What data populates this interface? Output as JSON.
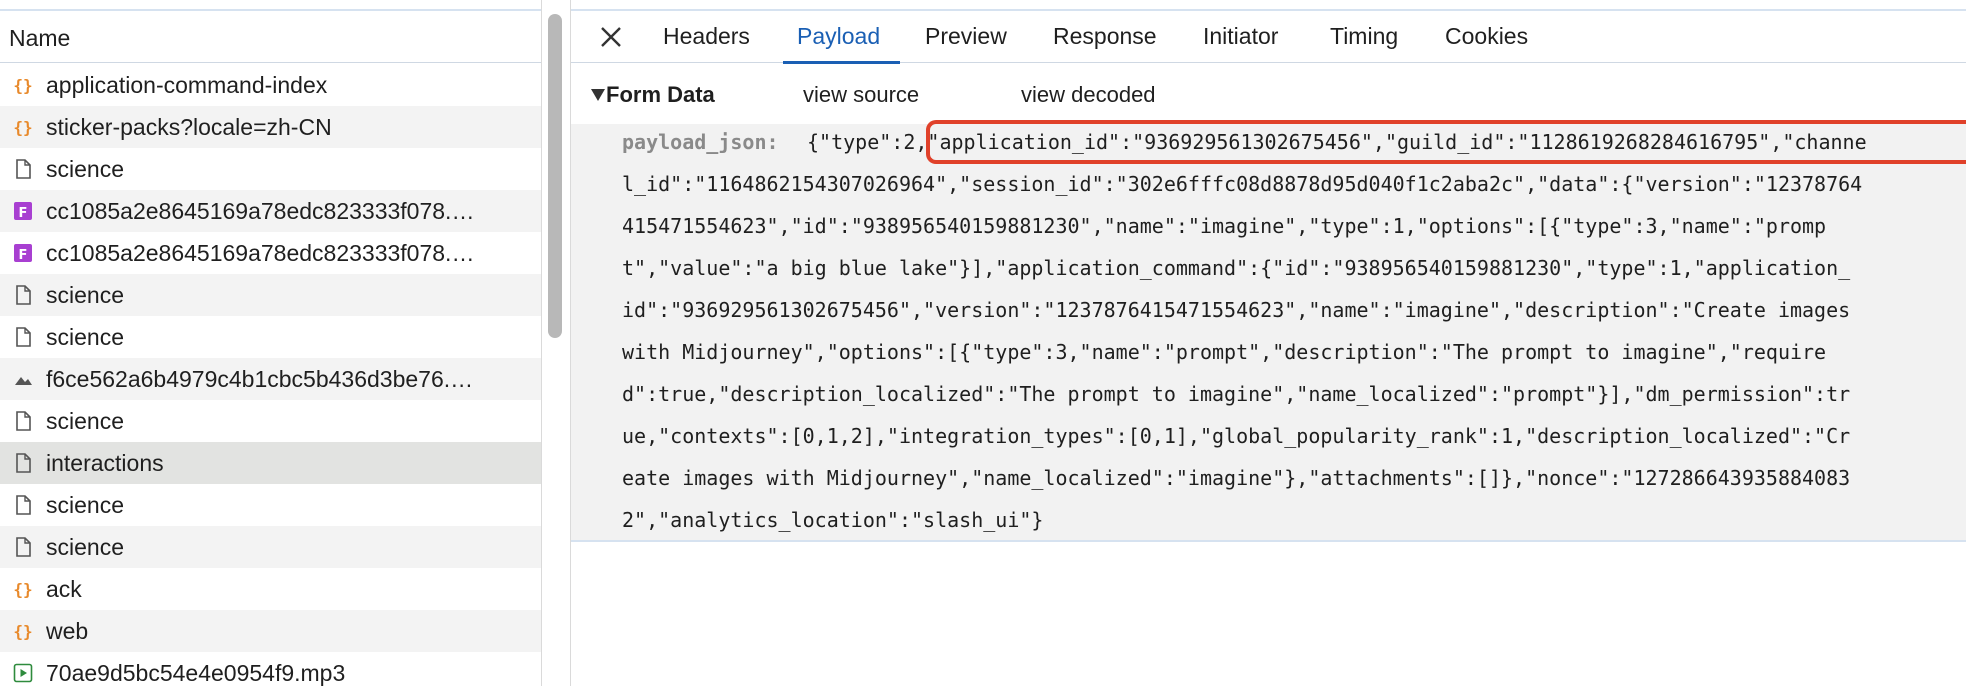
{
  "left_panel": {
    "header": "Name",
    "rows": [
      {
        "icon": "json-icon",
        "label": "application-command-index",
        "style": "plain"
      },
      {
        "icon": "json-icon",
        "label": "sticker-packs?locale=zh-CN",
        "style": "alt"
      },
      {
        "icon": "document-icon",
        "label": "science",
        "style": "plain"
      },
      {
        "icon": "font-icon",
        "label": "cc1085a2e8645169a78edc823333f078.…",
        "style": "alt"
      },
      {
        "icon": "font-icon",
        "label": "cc1085a2e8645169a78edc823333f078.…",
        "style": "plain"
      },
      {
        "icon": "document-icon",
        "label": "science",
        "style": "alt"
      },
      {
        "icon": "document-icon",
        "label": "science",
        "style": "plain"
      },
      {
        "icon": "image-icon",
        "label": "f6ce562a6b4979c4b1cbc5b436d3be76.…",
        "style": "alt"
      },
      {
        "icon": "document-icon",
        "label": "science",
        "style": "plain"
      },
      {
        "icon": "document-icon",
        "label": "interactions",
        "style": "sel"
      },
      {
        "icon": "document-icon",
        "label": "science",
        "style": "plain"
      },
      {
        "icon": "document-icon",
        "label": "science",
        "style": "alt"
      },
      {
        "icon": "json-icon",
        "label": "ack",
        "style": "plain"
      },
      {
        "icon": "json-icon",
        "label": "web",
        "style": "alt"
      },
      {
        "icon": "media-icon",
        "label": "70ae9d5bc54e4e0954f9.mp3",
        "style": "plain"
      }
    ]
  },
  "tabs": [
    {
      "label": "Headers",
      "active": false
    },
    {
      "label": "Payload",
      "active": true
    },
    {
      "label": "Preview",
      "active": false
    },
    {
      "label": "Response",
      "active": false
    },
    {
      "label": "Initiator",
      "active": false
    },
    {
      "label": "Timing",
      "active": false
    },
    {
      "label": "Cookies",
      "active": false
    }
  ],
  "form_data": {
    "title": "Form Data",
    "view_source": "view source",
    "view_decoded": "view decoded",
    "key": "payload_json:",
    "lines": [
      "{\"type\":2,\"application_id\":\"936929561302675456\",\"guild_id\":\"1128619268284616795\",\"channe",
      "l_id\":\"1164862154307026964\",\"session_id\":\"302e6fffc08d8878d95d040f1c2aba2c\",\"data\":{\"version\":\"12378764",
      "415471554623\",\"id\":\"938956540159881230\",\"name\":\"imagine\",\"type\":1,\"options\":[{\"type\":3,\"name\":\"promp",
      "t\",\"value\":\"a big blue lake\"}],\"application_command\":{\"id\":\"938956540159881230\",\"type\":1,\"application_",
      "id\":\"936929561302675456\",\"version\":\"1237876415471554623\",\"name\":\"imagine\",\"description\":\"Create images",
      "with Midjourney\",\"options\":[{\"type\":3,\"name\":\"prompt\",\"description\":\"The prompt to imagine\",\"require",
      "d\":true,\"description_localized\":\"The prompt to imagine\",\"name_localized\":\"prompt\"}],\"dm_permission\":tr",
      "ue,\"contexts\":[0,1,2],\"integration_types\":[0,1],\"global_popularity_rank\":1,\"description_localized\":\"Cr",
      "eate images with Midjourney\",\"name_localized\":\"imagine\"},\"attachments\":[]},\"nonce\":\"127286643935884083",
      "2\",\"analytics_location\":\"slash_ui\"}"
    ]
  },
  "colors": {
    "accent": "#1a5fb4",
    "highlight": "#e0412a",
    "json_icon": "#e8892a",
    "font_icon": "#a83fd1"
  }
}
